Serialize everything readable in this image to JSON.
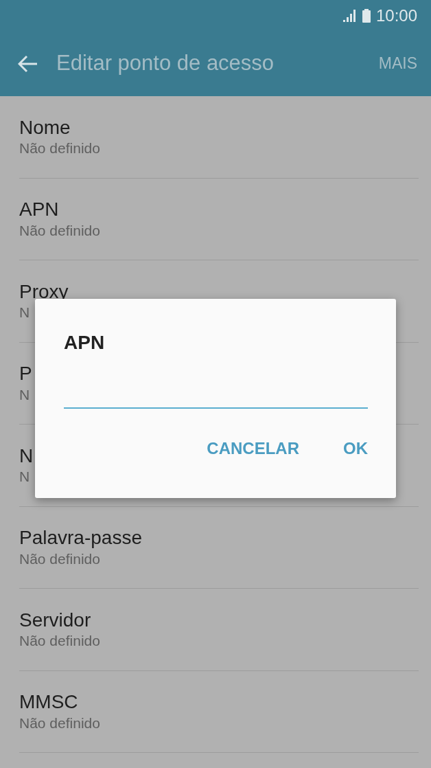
{
  "status_bar": {
    "time": "10:00"
  },
  "toolbar": {
    "title": "Editar ponto de acesso",
    "action": "MAIS"
  },
  "settings": [
    {
      "title": "Nome",
      "subtitle": "Não definido"
    },
    {
      "title": "APN",
      "subtitle": "Não definido"
    },
    {
      "title": "Proxy",
      "subtitle": "N"
    },
    {
      "title": "P",
      "subtitle": "N"
    },
    {
      "title": "N",
      "subtitle": "N"
    },
    {
      "title": "Palavra-passe",
      "subtitle": "Não definido"
    },
    {
      "title": "Servidor",
      "subtitle": "Não definido"
    },
    {
      "title": "MMSC",
      "subtitle": "Não definido"
    }
  ],
  "dialog": {
    "title": "APN",
    "buttons": [
      "CANCELAR",
      "OK"
    ]
  }
}
